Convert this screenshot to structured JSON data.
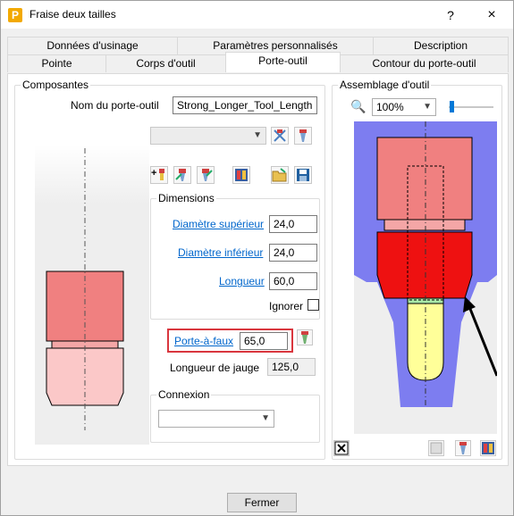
{
  "window": {
    "title": "Fraise deux tailles",
    "help": "?",
    "close": "×",
    "app_icon": "P"
  },
  "tabs": {
    "row1": [
      "Données d'usinage",
      "Paramètres personnalisés",
      "Description"
    ],
    "row2": [
      "Pointe",
      "Corps d'outil",
      "Porte-outil",
      "Contour du porte-outil"
    ]
  },
  "composantes": {
    "title": "Composantes",
    "holder_name_label": "Nom du porte-outil",
    "holder_name_value": "Strong_Longer_Tool_Length",
    "dimensions": {
      "title": "Dimensions",
      "top_diameter_label": "Diamètre supérieur",
      "top_diameter_value": "24,0",
      "bottom_diameter_label": "Diamètre inférieur",
      "bottom_diameter_value": "24,0",
      "length_label": "Longueur",
      "length_value": "60,0",
      "ignore_label": "Ignorer"
    },
    "overhang_label": "Porte-à-faux",
    "overhang_value": "65,0",
    "gauge_length_label": "Longueur de jauge",
    "gauge_length_value": "125,0",
    "connexion_title": "Connexion"
  },
  "assembly": {
    "title": "Assemblage d'outil",
    "zoom": "100%"
  },
  "footer": {
    "close_label": "Fermer"
  }
}
